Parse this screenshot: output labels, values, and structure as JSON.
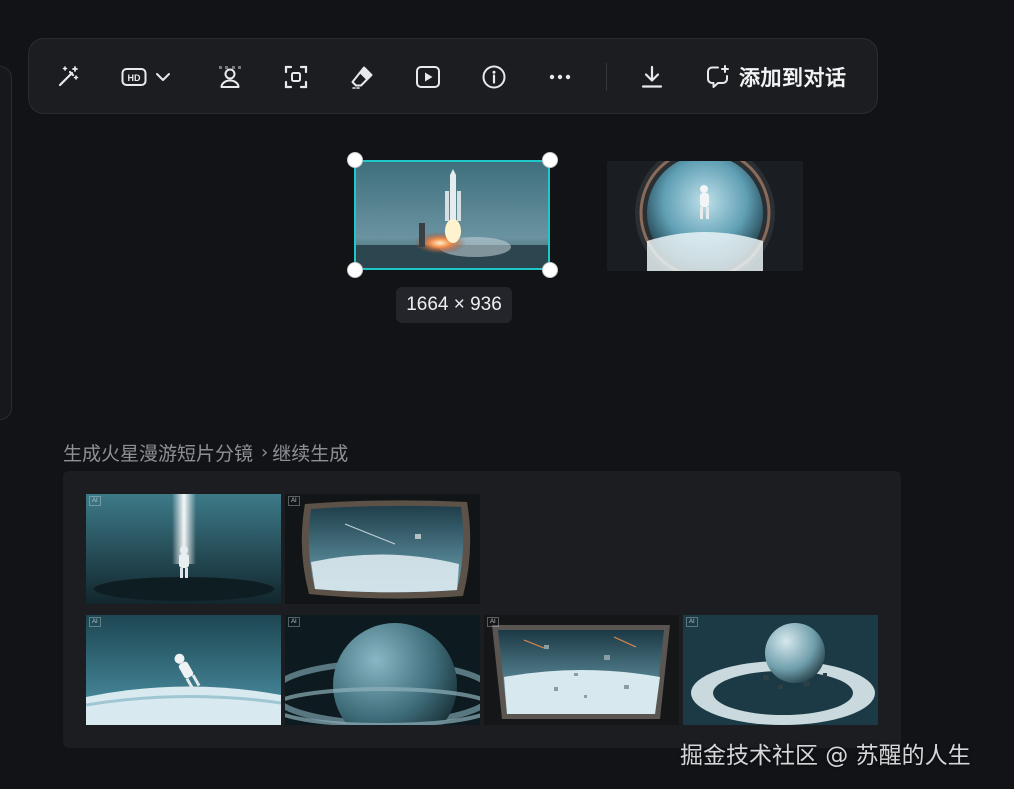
{
  "toolbar": {
    "buttons": [
      {
        "name": "magic-wand",
        "label": "magic wand"
      },
      {
        "name": "hd",
        "label": "HD"
      },
      {
        "name": "remove-background",
        "label": "remove background"
      },
      {
        "name": "expand",
        "label": "expand"
      },
      {
        "name": "eraser",
        "label": "eraser"
      },
      {
        "name": "play-video",
        "label": "generate video"
      },
      {
        "name": "info",
        "label": "info"
      },
      {
        "name": "more",
        "label": "more"
      },
      {
        "name": "download",
        "label": "download"
      }
    ],
    "hd_text": "HD",
    "add_to_chat_label": "添加到对话"
  },
  "canvas": {
    "selected_image": "rocket-launch",
    "dimension_label": "1664 × 936",
    "other_image": "astronaut-in-porthole"
  },
  "breadcrumb": {
    "parent": "生成火星漫游短片分镜",
    "separator": "›",
    "current": "继续生成"
  },
  "gallery": {
    "row1": [
      "astronaut-light-beam",
      "spaceship-window-earth"
    ],
    "row2": [
      "astronaut-floating-earth",
      "ringed-planet-dark",
      "window-debris-earth",
      "ringed-planet-shattered"
    ]
  },
  "watermark": "掘金技术社区 @ 苏醒的人生",
  "colors": {
    "background": "#121316",
    "panel": "#1c1d21",
    "selection_accent": "#1fc7c9",
    "text_primary": "#f2f3f5",
    "text_muted": "#8d9097"
  }
}
